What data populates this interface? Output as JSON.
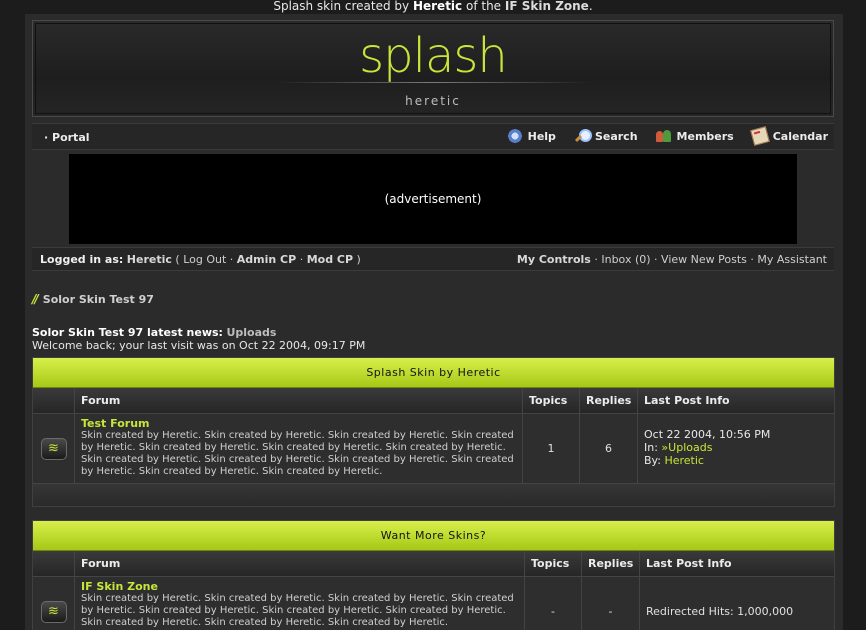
{
  "credit": {
    "prefix": "Splash skin created by",
    "author": "Heretic",
    "mid": "of the",
    "zone": "IF Skin Zone",
    "suffix": "."
  },
  "banner": {
    "logo": "splash",
    "subtitle": "heretic"
  },
  "nav": {
    "portal": "Portal",
    "links": [
      {
        "label": "Help",
        "icon": "help-icon"
      },
      {
        "label": "Search",
        "icon": "search-icon"
      },
      {
        "label": "Members",
        "icon": "members-icon"
      },
      {
        "label": "Calendar",
        "icon": "calendar-icon"
      }
    ]
  },
  "ad": {
    "text": "(advertisement)"
  },
  "userbar": {
    "logged_label": "Logged in as:",
    "user": "Heretic",
    "open": "(",
    "logout": "Log Out",
    "admin": "Admin CP",
    "mod": "Mod CP",
    "close": ")",
    "sep": "·",
    "my_controls": "My Controls",
    "inbox": "Inbox (0)",
    "view_new": "View New Posts",
    "assistant": "My Assistant"
  },
  "breadcrumb": {
    "text": "Solor Skin Test 97"
  },
  "news": {
    "label": "Solor Skin Test 97 latest news:",
    "link": "Uploads",
    "welcome": "Welcome back; your last visit was on Oct 22 2004, 09:17 PM"
  },
  "columns": {
    "forum": "Forum",
    "topics": "Topics",
    "replies": "Replies",
    "last": "Last Post Info"
  },
  "categories": [
    {
      "title": "Splash Skin by Heretic",
      "forums": [
        {
          "name": "Test Forum",
          "desc": "Skin created by Heretic. Skin created by Heretic. Skin created by Heretic. Skin created by Heretic. Skin created by Heretic. Skin created by Heretic. Skin created by Heretic. Skin created by Heretic. Skin created by Heretic. Skin created by Heretic. Skin created by Heretic. Skin created by Heretic. Skin created by Heretic.",
          "topics": "1",
          "replies": "6",
          "last_date": "Oct 22 2004, 10:56 PM",
          "in_label": "In:",
          "in_marker": "»",
          "in_link": "Uploads",
          "by_label": "By:",
          "by_link": "Heretic"
        }
      ]
    },
    {
      "title": "Want More Skins?",
      "forums": [
        {
          "name": "IF Skin Zone",
          "desc": "Skin created by Heretic. Skin created by Heretic. Skin created by Heretic. Skin created by Heretic. Skin created by Heretic. Skin created by Heretic. Skin created by Heretic. Skin created by Heretic. Skin created by Heretic. Skin created by Heretic.",
          "topics": "-",
          "replies": "-",
          "redirect": "Redirected Hits: 1,000,000"
        }
      ]
    }
  ]
}
